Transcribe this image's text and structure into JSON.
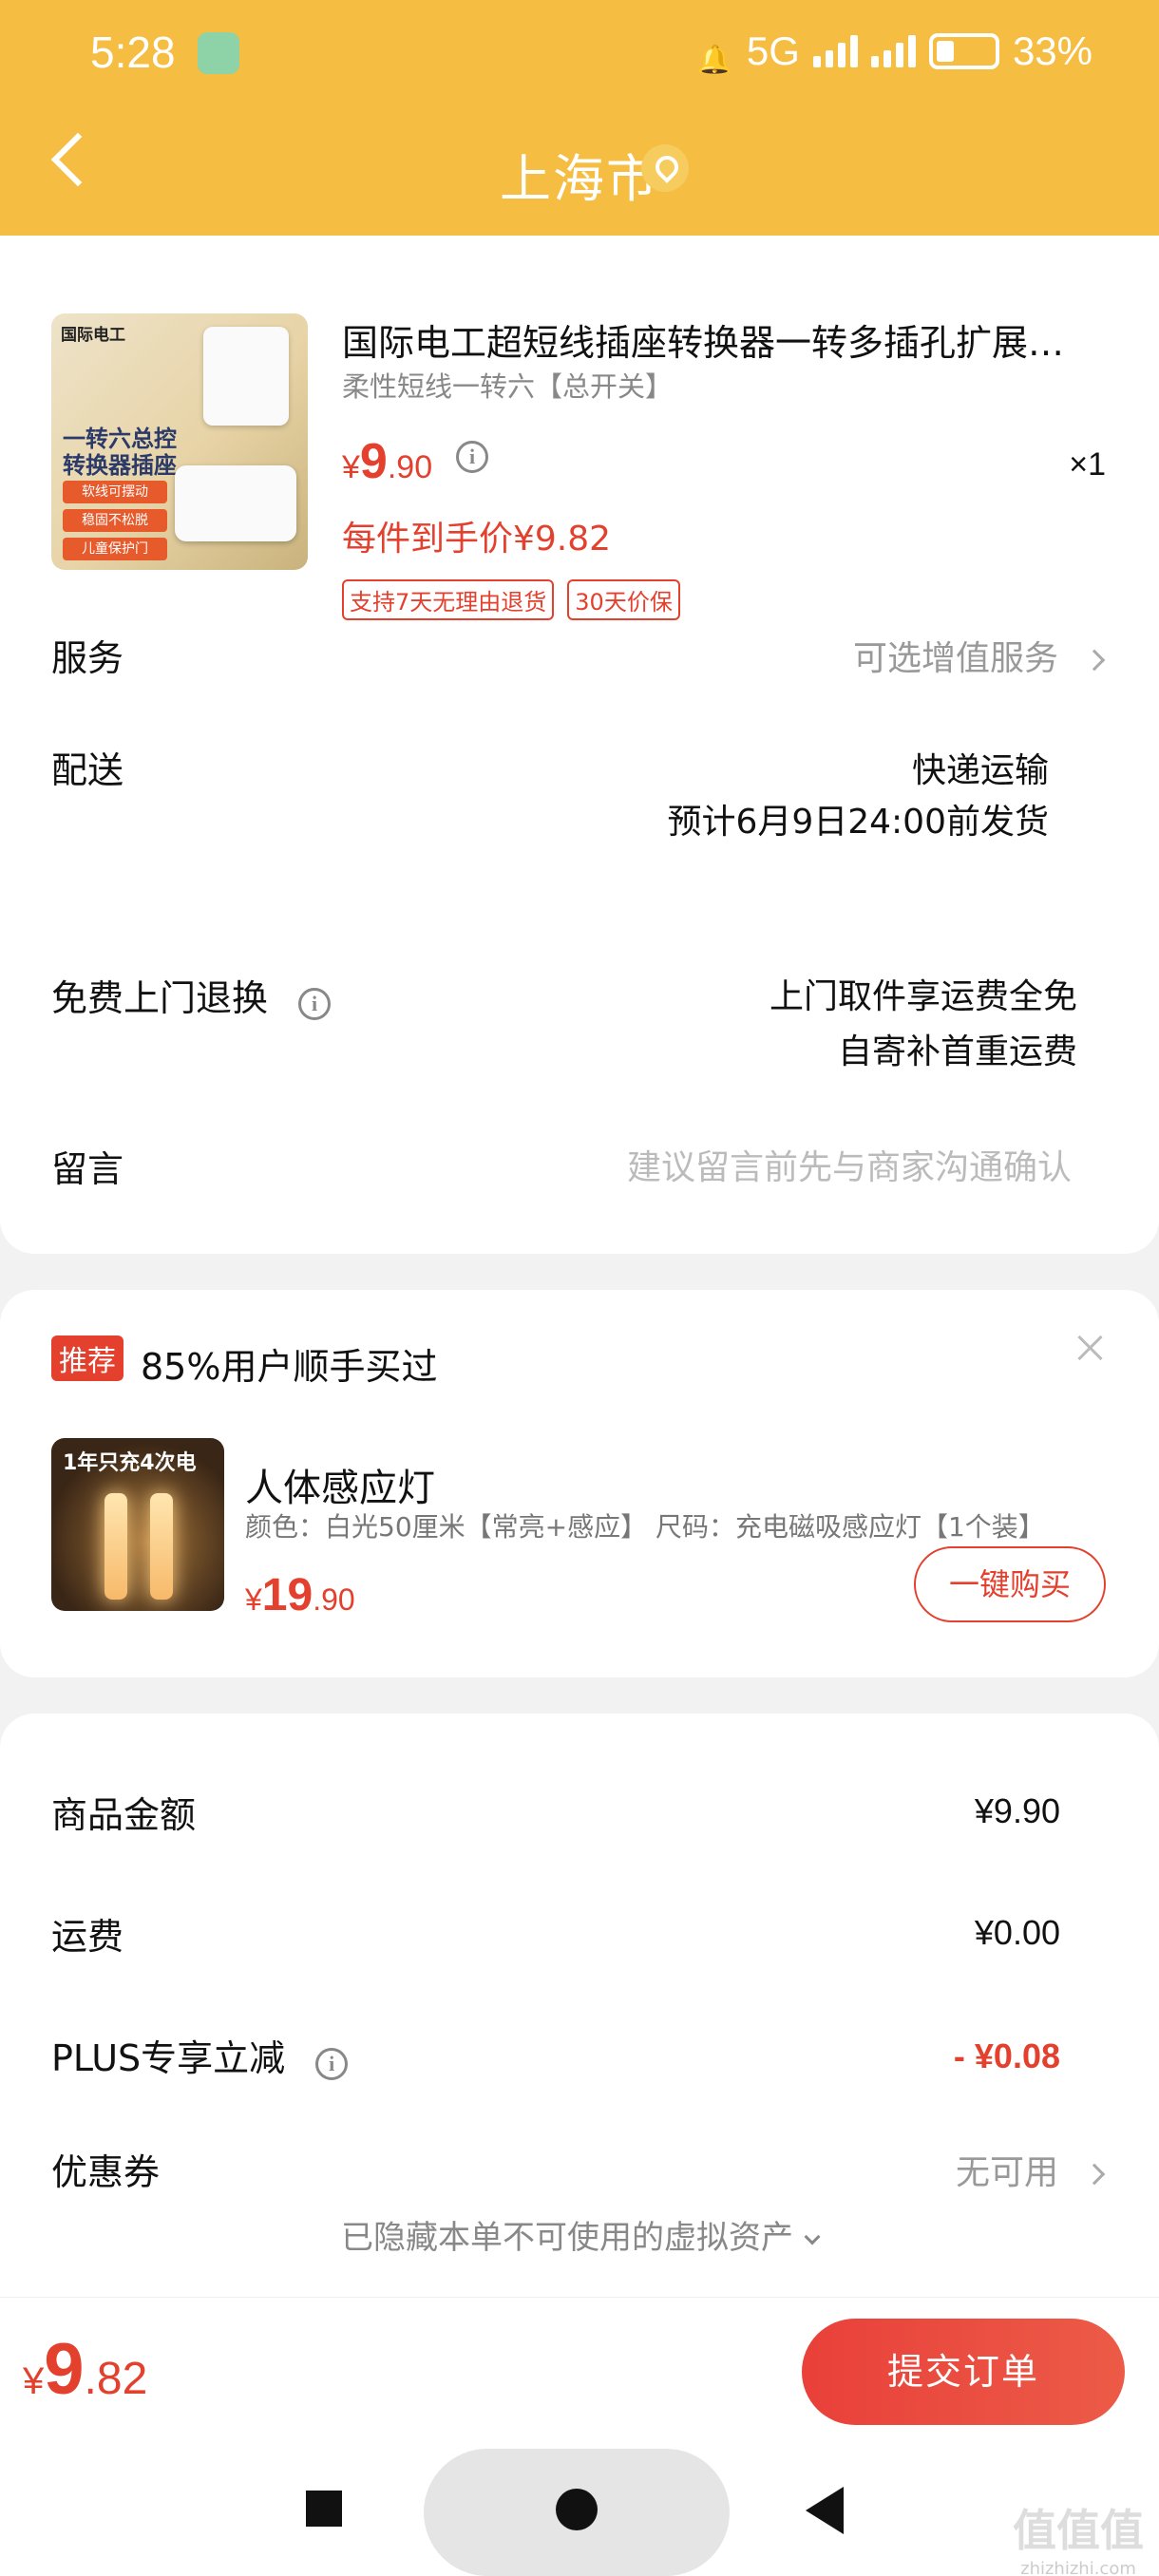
{
  "status_bar": {
    "time": "5:28",
    "network": "5G",
    "battery": "33%"
  },
  "header": {
    "title": "上海市"
  },
  "product": {
    "image_brand": "国际电工",
    "image_headline": "一转六总控 转换器插座",
    "image_pills": [
      "软线可摆动",
      "稳固不松脱",
      "儿童保护门"
    ],
    "title": "国际电工超短线插座转换器一转多插孔扩展…",
    "spec": "柔性短线一转六【总开关】",
    "price_yen": "¥",
    "price_int": "9",
    "price_dec": ".90",
    "quantity": "×1",
    "unit_price": "每件到手价¥9.82",
    "tags": [
      "支持7天无理由退货",
      "30天价保"
    ]
  },
  "rows": {
    "service_label": "服务",
    "service_value": "可选增值服务",
    "delivery_label": "配送",
    "delivery_value1": "快递运输",
    "delivery_value2": "预计6月9日24:00前发货",
    "return_label": "免费上门退换",
    "return_value1": "上门取件享运费全免",
    "return_value2": "自寄补首重运费",
    "note_label": "留言",
    "note_placeholder": "建议留言前先与商家沟通确认"
  },
  "recommend": {
    "badge": "推荐",
    "title": "85%用户顺手买过",
    "image_text": "1年只充4次电",
    "name": "人体感应灯",
    "spec": "颜色：白光50厘米【常亮+感应】  尺码：充电磁吸感应灯【1个装】",
    "price_yen": "¥",
    "price_int": "19",
    "price_dec": ".90",
    "buy_label": "一键购买"
  },
  "summary": {
    "goods_label": "商品金额",
    "goods_value": "¥9.90",
    "shipping_label": "运费",
    "shipping_value": "¥0.00",
    "plus_label": "PLUS专享立减",
    "plus_value": "- ¥0.08",
    "coupon_label": "优惠券",
    "coupon_value": "无可用",
    "hidden_note": "已隐藏本单不可使用的虚拟资产"
  },
  "bottom": {
    "total_yen": "¥",
    "total_int": "9",
    "total_dec": ".82",
    "submit_label": "提交订单"
  },
  "watermark": {
    "main": "值值值",
    "sub": "zhizhizhi.com"
  },
  "colors": {
    "header": "#f5bd42",
    "accent": "#e4402e"
  }
}
